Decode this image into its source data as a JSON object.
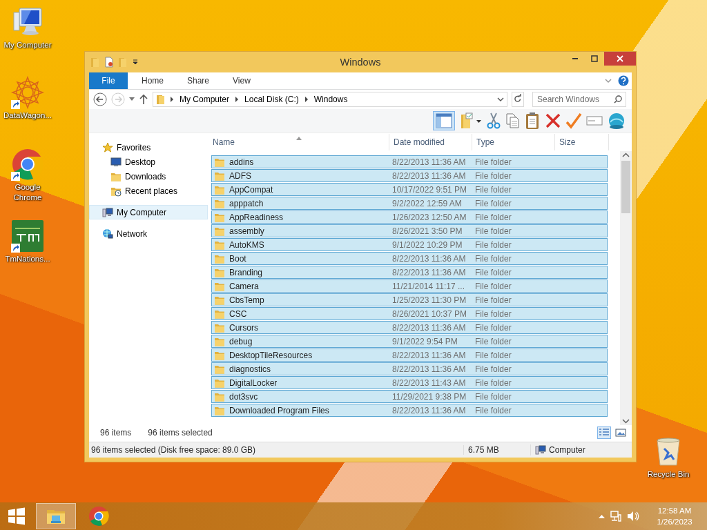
{
  "desktop_icons": [
    {
      "label": "My Computer",
      "kind": "computer",
      "shortcut": false
    },
    {
      "label": "DataWagon...",
      "kind": "mandala",
      "shortcut": true
    },
    {
      "label": "Google Chrome",
      "kind": "chrome",
      "shortcut": true
    },
    {
      "label": "TmNations...",
      "kind": "game",
      "shortcut": true
    },
    {
      "label": "Recycle Bin",
      "kind": "recycle",
      "shortcut": false
    }
  ],
  "window": {
    "title": "Windows",
    "file_tab": "File",
    "ribbon_tabs": [
      "Home",
      "Share",
      "View"
    ],
    "address": {
      "crumbs": [
        "My Computer",
        "Local Disk (C:)",
        "Windows"
      ]
    },
    "search": {
      "placeholder": "Search Windows"
    },
    "nav": [
      {
        "label": "Favorites",
        "kind": "star",
        "selected": false,
        "children": [
          {
            "label": "Desktop",
            "kind": "desktop",
            "selected": false
          },
          {
            "label": "Downloads",
            "kind": "folder",
            "selected": false
          },
          {
            "label": "Recent places",
            "kind": "recent",
            "selected": false
          }
        ]
      },
      {
        "label": "My Computer",
        "kind": "computer",
        "selected": true
      },
      {
        "label": "Network",
        "kind": "network",
        "selected": false
      }
    ],
    "columns": [
      "Name",
      "Date modified",
      "Type",
      "Size"
    ],
    "rows": [
      {
        "name": "addins",
        "date": "8/22/2013 11:36 AM",
        "type": "File folder",
        "selected": true
      },
      {
        "name": "ADFS",
        "date": "8/22/2013 11:36 AM",
        "type": "File folder",
        "selected": true
      },
      {
        "name": "AppCompat",
        "date": "10/17/2022 9:51 PM",
        "type": "File folder",
        "selected": true
      },
      {
        "name": "apppatch",
        "date": "9/2/2022 12:59 AM",
        "type": "File folder",
        "selected": true
      },
      {
        "name": "AppReadiness",
        "date": "1/26/2023 12:50 AM",
        "type": "File folder",
        "selected": true
      },
      {
        "name": "assembly",
        "date": "8/26/2021 3:50 PM",
        "type": "File folder",
        "selected": true
      },
      {
        "name": "AutoKMS",
        "date": "9/1/2022 10:29 PM",
        "type": "File folder",
        "selected": true
      },
      {
        "name": "Boot",
        "date": "8/22/2013 11:36 AM",
        "type": "File folder",
        "selected": true
      },
      {
        "name": "Branding",
        "date": "8/22/2013 11:36 AM",
        "type": "File folder",
        "selected": true
      },
      {
        "name": "Camera",
        "date": "11/21/2014 11:17 ...",
        "type": "File folder",
        "selected": true
      },
      {
        "name": "CbsTemp",
        "date": "1/25/2023 11:30 PM",
        "type": "File folder",
        "selected": true
      },
      {
        "name": "CSC",
        "date": "8/26/2021 10:37 PM",
        "type": "File folder",
        "selected": true
      },
      {
        "name": "Cursors",
        "date": "8/22/2013 11:36 AM",
        "type": "File folder",
        "selected": true
      },
      {
        "name": "debug",
        "date": "9/1/2022 9:54 PM",
        "type": "File folder",
        "selected": true
      },
      {
        "name": "DesktopTileResources",
        "date": "8/22/2013 11:36 AM",
        "type": "File folder",
        "selected": true
      },
      {
        "name": "diagnostics",
        "date": "8/22/2013 11:36 AM",
        "type": "File folder",
        "selected": true
      },
      {
        "name": "DigitalLocker",
        "date": "8/22/2013 11:43 AM",
        "type": "File folder",
        "selected": true
      },
      {
        "name": "dot3svc",
        "date": "11/29/2021 9:38 PM",
        "type": "File folder",
        "selected": true
      },
      {
        "name": "Downloaded Program Files",
        "date": "8/22/2013 11:36 AM",
        "type": "File folder",
        "selected": true
      }
    ],
    "item_count": "96 items",
    "selection_count": "96 items selected",
    "status_bar": {
      "text": "96 items selected (Disk free space: 89.0 GB)",
      "size": "6.75 MB",
      "location": "Computer"
    }
  },
  "taskbar": {
    "apps": [
      {
        "kind": "explorer",
        "selected": true
      },
      {
        "kind": "chrome",
        "selected": false
      }
    ],
    "clock": {
      "time": "12:58 AM",
      "date": "1/26/2023"
    }
  }
}
